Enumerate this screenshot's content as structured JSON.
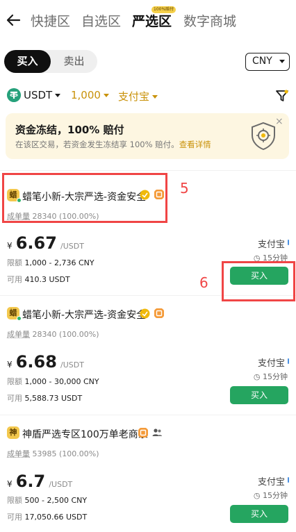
{
  "nav": {
    "tabs": [
      "快捷区",
      "自选区",
      "严选区",
      "数字商城"
    ],
    "active_index": 2,
    "active_badge": "100%赔付"
  },
  "trade_toggle": {
    "buy": "买入",
    "sell": "卖出",
    "selected": "buy"
  },
  "currency": "CNY",
  "filters": {
    "asset": "USDT",
    "amount": "1,000",
    "payment": "支付宝"
  },
  "banner": {
    "title": "资金冻结，100% 赔付",
    "subtitle": "在该区交易，若资金发生冻结享 100% 赔付。",
    "link": "查看详情",
    "close": "×"
  },
  "labels": {
    "orders": "成单量",
    "limit": "限额",
    "available": "可用",
    "currency_symbol": "¥",
    "unit": "/USDT",
    "payment": "支付宝",
    "time": "15分钟",
    "buy": "买入"
  },
  "listings": [
    {
      "avatar": "蜡",
      "name": "蜡笔小新-大宗严选-资金安全",
      "orders": "28340 (100.00%)",
      "price": "6.67",
      "limit": "1,000 - 2,736 CNY",
      "available": "410.3 USDT"
    },
    {
      "avatar": "蜡",
      "name": "蜡笔小新-大宗严选-资金安全",
      "orders": "28340 (100.00%)",
      "price": "6.68",
      "limit": "1,000 - 30,000 CNY",
      "available": "5,588.73 USDT"
    },
    {
      "avatar": "神",
      "name": "神盾严选专区100万单老商家",
      "orders": "53985 (100.00%)",
      "price": "6.7",
      "limit": "500 - 2,500 CNY",
      "available": "17,050.66 USDT"
    }
  ],
  "annotations": [
    "5",
    "6"
  ],
  "colors": {
    "accent_gold": "#c9920a",
    "buy_green": "#25a560",
    "annotation_red": "#f04545"
  }
}
